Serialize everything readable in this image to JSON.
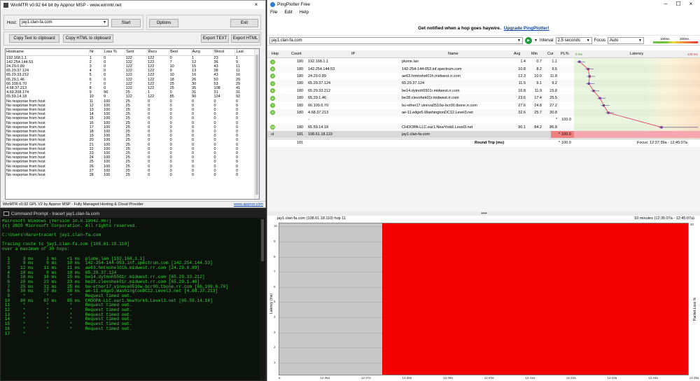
{
  "winmtr": {
    "title": "WinMTR v0.92 64 bit by Appnor MSP - www.winmtr.net",
    "host_label": "Host:",
    "host_value": "jay1.clan-fa.com",
    "start_label": "Start",
    "options_label": "Options",
    "exit_label": "Exit",
    "copy_text_label": "Copy Text to clipboard",
    "copy_html_label": "Copy HTML to clipboard",
    "export_text_label": "Export TEXT",
    "export_html_label": "Export HTML",
    "columns": [
      "Hostname",
      "Nr",
      "Loss %",
      "Sent",
      "Recv",
      "Best",
      "Avrg",
      "Worst",
      "Last"
    ],
    "rows": [
      [
        "192.168.1.1",
        "1",
        "0",
        "122",
        "122",
        "0",
        "1",
        "23",
        "1"
      ],
      [
        "142.254.144.53",
        "2",
        "0",
        "122",
        "122",
        "7",
        "12",
        "36",
        "9"
      ],
      [
        "24.29.0.89",
        "3",
        "0",
        "122",
        "122",
        "10",
        "15",
        "43",
        "11"
      ],
      [
        "65.29.37.124",
        "4",
        "0",
        "122",
        "122",
        "9",
        "13",
        "38",
        "11"
      ],
      [
        "65.29.33.212",
        "5",
        "0",
        "122",
        "122",
        "10",
        "16",
        "43",
        "16"
      ],
      [
        "65.29.1.46",
        "6",
        "0",
        "122",
        "122",
        "18",
        "26",
        "50",
        "20"
      ],
      [
        "66.109.6.70",
        "7",
        "0",
        "122",
        "122",
        "25",
        "30",
        "53",
        "29"
      ],
      [
        "4.68.37.213",
        "8",
        "0",
        "122",
        "122",
        "25",
        "35",
        "108",
        "41"
      ],
      [
        "4.69.208.174",
        "9",
        "96",
        "25",
        "1",
        "0",
        "31",
        "31",
        "31"
      ],
      [
        "65.59.14.18",
        "10",
        "0",
        "122",
        "122",
        "85",
        "90",
        "124",
        "92"
      ],
      [
        "No response from host",
        "11",
        "100",
        "25",
        "0",
        "0",
        "0",
        "0",
        "0"
      ],
      [
        "No response from host",
        "12",
        "100",
        "25",
        "0",
        "0",
        "0",
        "0",
        "0"
      ],
      [
        "No response from host",
        "13",
        "100",
        "25",
        "0",
        "0",
        "0",
        "0",
        "0"
      ],
      [
        "No response from host",
        "14",
        "100",
        "25",
        "0",
        "0",
        "0",
        "0",
        "0"
      ],
      [
        "No response from host",
        "15",
        "100",
        "25",
        "0",
        "0",
        "0",
        "0",
        "0"
      ],
      [
        "No response from host",
        "16",
        "100",
        "25",
        "0",
        "0",
        "0",
        "0",
        "0"
      ],
      [
        "No response from host",
        "17",
        "100",
        "25",
        "0",
        "0",
        "0",
        "0",
        "0"
      ],
      [
        "No response from host",
        "18",
        "100",
        "25",
        "0",
        "0",
        "0",
        "0",
        "0"
      ],
      [
        "No response from host",
        "19",
        "100",
        "25",
        "0",
        "0",
        "0",
        "0",
        "0"
      ],
      [
        "No response from host",
        "20",
        "100",
        "25",
        "0",
        "0",
        "0",
        "0",
        "0"
      ],
      [
        "No response from host",
        "21",
        "100",
        "25",
        "0",
        "0",
        "0",
        "0",
        "0"
      ],
      [
        "No response from host",
        "22",
        "100",
        "25",
        "0",
        "0",
        "0",
        "0",
        "0"
      ],
      [
        "No response from host",
        "23",
        "100",
        "25",
        "0",
        "0",
        "0",
        "0",
        "0"
      ],
      [
        "No response from host",
        "24",
        "100",
        "25",
        "0",
        "0",
        "0",
        "0",
        "0"
      ],
      [
        "No response from host",
        "25",
        "100",
        "25",
        "0",
        "0",
        "0",
        "0",
        "0"
      ],
      [
        "No response from host",
        "26",
        "100",
        "25",
        "0",
        "0",
        "0",
        "0",
        "0"
      ],
      [
        "No response from host",
        "27",
        "100",
        "25",
        "0",
        "0",
        "0",
        "0",
        "0"
      ],
      [
        "No response from host",
        "28",
        "100",
        "25",
        "0",
        "0",
        "0",
        "0",
        "0"
      ]
    ],
    "status": "WinMTR v0.92 GPL V2 by Appnor MSP - Fully Managed Hosting & Cloud Provider",
    "status_link": "www.appnor.com"
  },
  "cmd": {
    "title": "Command Prompt - tracert  jay1.clan-fa.com",
    "lines": [
      "Microsoft Windows [Version 10.0.19042.867]",
      "(c) 2020 Microsoft Corporation. All rights reserved.",
      "",
      "C:\\Users\\Haru>tracert jay1.clan-fa.com",
      "",
      "Tracing route to jay1.clan-fa.com [108.61.18.110]",
      "over a maximum of 30 hops:",
      "",
      "  1     3 ms     1 ms    <1 ms  plume.lan [192.168.1.1]",
      "  2     9 ms     9 ms    10 ms  142-254-144-053.inf.spectrum.com [142.254.144.53]",
      "  3    12 ms    11 ms    11 ms  ae63.hmtnohel01h.midwest.rr.com [24.29.0.89]",
      "  4    10 ms     9 ms    10 ms  65.29.37.124",
      "  5    16 ms    16 ms    15 ms  be14.dytnoh5501r.midwest.rr.com [65.29.33.212]",
      "  6    20 ms    23 ms    23 ms  be28.clevohek01r.midwest.rr.com [65.29.1.46]",
      "  7    25 ms    31 ms    25 ms  bu-ether17.vinnva0510w-bcr00.tbone.rr.com [66.109.6.70]",
      "  8    30 ms    27 ms    28 ms  ae-11.edge5.WashingtonDC12.Level3.net [4.68.37.213]",
      "  9     *        *        *     Request timed out.",
      " 10    90 ms    87 ms    85 ms  CHOOPA-LLC.ear1.NewYork6.Level3.net [65.59.14.18]",
      " 11     *        *        *     Request timed out.",
      " 12     *        *        *     Request timed out.",
      " 13     *        *        *     Request timed out.",
      " 14     *        *        *     Request timed out.",
      " 15     *        *        *     Request timed out.",
      " 16     *        *        *     Request timed out.",
      " 17     *"
    ]
  },
  "pingplotter": {
    "title": "PingPlotter Free",
    "menu": [
      "File",
      "Edit",
      "Help"
    ],
    "notify_text": "Get notified when a hop goes haywire.",
    "notify_link": "Upgrade PingPlotter!",
    "target": "jay1.clan-fa.com",
    "interval_label": "Interval",
    "interval_value": "2.5 seconds",
    "focus_label": "Focus",
    "focus_value": "Auto",
    "scale_labels": [
      "100ms",
      "200ms"
    ],
    "columns": [
      "Hop",
      "Count",
      "IP",
      "Name",
      "Avg",
      "Min",
      "Cur",
      "PL%",
      "Latency"
    ],
    "latency_scale": [
      "0 ms",
      "128 ms"
    ],
    "hops": [
      {
        "hop": "1",
        "count": "180",
        "ip": "192.168.1.1",
        "name": "plume.lan",
        "avg": "1.4",
        "min": "0.7",
        "cur": "1.1",
        "pl": ""
      },
      {
        "hop": "2",
        "count": "180",
        "ip": "142.254.144.53",
        "name": "142-254-144-053.inf.spectrum.com",
        "avg": "10.8",
        "min": "8.2",
        "cur": "9.5",
        "pl": ""
      },
      {
        "hop": "3",
        "count": "180",
        "ip": "24.29.0.89",
        "name": "ae63.hmtnohel01h.midwest.rr.com",
        "avg": "12.3",
        "min": "10.0",
        "cur": "11.8",
        "pl": ""
      },
      {
        "hop": "4",
        "count": "180",
        "ip": "65.29.37.124",
        "name": "65.29.37.124",
        "avg": "11.5",
        "min": "9.1",
        "cur": "9.2",
        "pl": ""
      },
      {
        "hop": "5",
        "count": "180",
        "ip": "65.29.33.212",
        "name": "be14.dytnoh5501r.midwest.rr.com",
        "avg": "16.8",
        "min": "11.9",
        "cur": "15.8",
        "pl": ""
      },
      {
        "hop": "6",
        "count": "180",
        "ip": "65.29.1.46",
        "name": "be28.clevohek01r.midwest.rr.com",
        "avg": "23.6",
        "min": "17.4",
        "cur": "25.5",
        "pl": ""
      },
      {
        "hop": "7",
        "count": "180",
        "ip": "66.109.6.70",
        "name": "bu-ether17.vinnva0510w-bcr00.tbone.rr.com",
        "avg": "27.6",
        "min": "24.8",
        "cur": "27.2",
        "pl": ""
      },
      {
        "hop": "8",
        "count": "180",
        "ip": "4.68.37.213",
        "name": "ae-11.edge5.WashingtonDC12.Level3.net",
        "avg": "32.6",
        "min": "25.7",
        "cur": "30.8",
        "pl": ""
      },
      {
        "hop": "",
        "count": "",
        "ip": "-",
        "name": "",
        "avg": "",
        "min": "",
        "cur": "*",
        "pl": "100.0"
      },
      {
        "hop": "10",
        "count": "180",
        "ip": "65.59.14.18",
        "name": "CHOOPA-LLC.ear1.NewYork6.Level3.net",
        "avg": "90.1",
        "min": "84.2",
        "cur": "86.8",
        "pl": ""
      }
    ],
    "final_hop": {
      "hop": "11",
      "count": "181",
      "ip": "108.61.18.110",
      "name": "jay1.clan-fa.com",
      "cur": "*",
      "pl": "100.0"
    },
    "summary": {
      "count": "181",
      "label": "Round Trip (ms)",
      "cur": "*",
      "pl": "100.0",
      "focus": "Focus: 12:37:39a - 12:45:07a"
    },
    "graph_title": "jay1.clan-fa.com (108.61.18.110) hop 11",
    "graph_range": "10 minutes (12:35:07a - 12:45:07a)",
    "graph_y_left": "Latency (ms)",
    "graph_y_right": "Packet Loss %",
    "graph_y_ticks": [
      "10",
      "9",
      "8",
      "7",
      "6",
      "5",
      "4",
      "3",
      "2",
      "1"
    ],
    "graph_right_top": "30",
    "graph_x_ticks": [
      "a",
      "12:36a",
      "12:37a",
      "12:38a",
      "12:39a",
      "12:40a",
      "12:41a",
      "12:42a",
      "12:43a",
      "12:44a",
      "12:45a"
    ],
    "latency_avg_ms": [
      1.4,
      10.8,
      12.3,
      11.5,
      16.8,
      23.6,
      27.6,
      32.6,
      null,
      90.1
    ],
    "latency_max_ms": 128,
    "loss_start_fraction": 0.25
  },
  "colors": {
    "cmd_text": "#34d734",
    "hop_ok": "#6fc23f",
    "loss_red": "#f20000",
    "latency_line": "#e0325a"
  }
}
